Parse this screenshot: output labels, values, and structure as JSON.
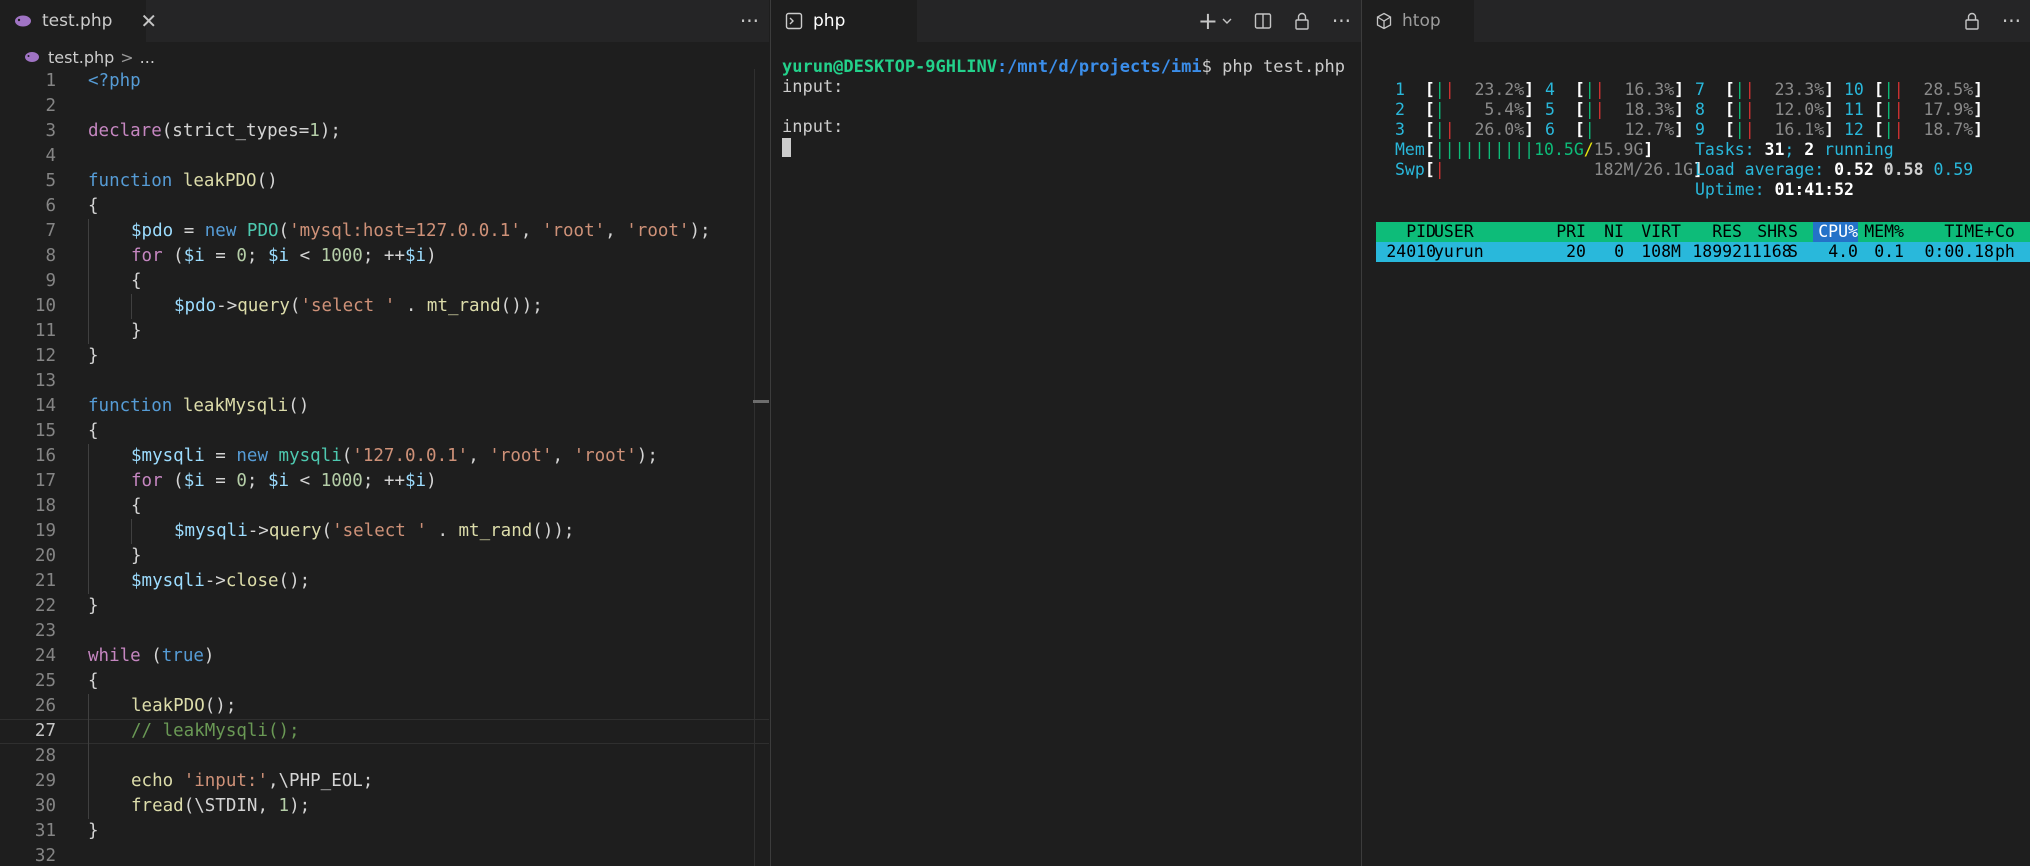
{
  "editor": {
    "tab_label": "test.php",
    "tab_close": "✕",
    "more": "···",
    "breadcrumb_file": "test.php",
    "breadcrumb_sep": ">",
    "breadcrumb_rest": "...",
    "lines": [
      {
        "n": "1",
        "tokens": [
          {
            "t": "<?php",
            "c": "t-kw"
          }
        ]
      },
      {
        "n": "2",
        "tokens": []
      },
      {
        "n": "3",
        "tokens": [
          {
            "t": "declare",
            "c": "t-cf"
          },
          {
            "t": "(strict_types=",
            "c": "t-plain"
          },
          {
            "t": "1",
            "c": "t-num"
          },
          {
            "t": ");",
            "c": "t-plain"
          }
        ]
      },
      {
        "n": "4",
        "tokens": []
      },
      {
        "n": "5",
        "tokens": [
          {
            "t": "function ",
            "c": "t-kw"
          },
          {
            "t": "leakPDO",
            "c": "t-fn"
          },
          {
            "t": "()",
            "c": "t-plain"
          }
        ]
      },
      {
        "n": "6",
        "tokens": [
          {
            "t": "{",
            "c": "t-plain"
          }
        ]
      },
      {
        "n": "7",
        "indent": 1,
        "tokens": [
          {
            "t": "$pdo",
            "c": "t-var"
          },
          {
            "t": " = ",
            "c": "t-plain"
          },
          {
            "t": "new ",
            "c": "t-kw"
          },
          {
            "t": "PDO",
            "c": "t-cls"
          },
          {
            "t": "(",
            "c": "t-plain"
          },
          {
            "t": "'mysql:host=127.0.0.1'",
            "c": "t-str"
          },
          {
            "t": ", ",
            "c": "t-plain"
          },
          {
            "t": "'root'",
            "c": "t-str"
          },
          {
            "t": ", ",
            "c": "t-plain"
          },
          {
            "t": "'root'",
            "c": "t-str"
          },
          {
            "t": ");",
            "c": "t-plain"
          }
        ]
      },
      {
        "n": "8",
        "indent": 1,
        "tokens": [
          {
            "t": "for",
            "c": "t-cf"
          },
          {
            "t": " (",
            "c": "t-plain"
          },
          {
            "t": "$i",
            "c": "t-var"
          },
          {
            "t": " = ",
            "c": "t-plain"
          },
          {
            "t": "0",
            "c": "t-num"
          },
          {
            "t": "; ",
            "c": "t-plain"
          },
          {
            "t": "$i",
            "c": "t-var"
          },
          {
            "t": " < ",
            "c": "t-plain"
          },
          {
            "t": "1000",
            "c": "t-num"
          },
          {
            "t": "; ++",
            "c": "t-plain"
          },
          {
            "t": "$i",
            "c": "t-var"
          },
          {
            "t": ")",
            "c": "t-plain"
          }
        ]
      },
      {
        "n": "9",
        "indent": 1,
        "tokens": [
          {
            "t": "{",
            "c": "t-plain"
          }
        ]
      },
      {
        "n": "10",
        "indent": 2,
        "tokens": [
          {
            "t": "$pdo",
            "c": "t-var"
          },
          {
            "t": "->",
            "c": "t-plain"
          },
          {
            "t": "query",
            "c": "t-fn"
          },
          {
            "t": "(",
            "c": "t-plain"
          },
          {
            "t": "'select '",
            "c": "t-str"
          },
          {
            "t": " . ",
            "c": "t-plain"
          },
          {
            "t": "mt_rand",
            "c": "t-fn"
          },
          {
            "t": "());",
            "c": "t-plain"
          }
        ]
      },
      {
        "n": "11",
        "indent": 1,
        "tokens": [
          {
            "t": "}",
            "c": "t-plain"
          }
        ]
      },
      {
        "n": "12",
        "tokens": [
          {
            "t": "}",
            "c": "t-plain"
          }
        ]
      },
      {
        "n": "13",
        "tokens": []
      },
      {
        "n": "14",
        "tokens": [
          {
            "t": "function ",
            "c": "t-kw"
          },
          {
            "t": "leakMysqli",
            "c": "t-fn"
          },
          {
            "t": "()",
            "c": "t-plain"
          }
        ]
      },
      {
        "n": "15",
        "tokens": [
          {
            "t": "{",
            "c": "t-plain"
          }
        ]
      },
      {
        "n": "16",
        "indent": 1,
        "tokens": [
          {
            "t": "$mysqli",
            "c": "t-var"
          },
          {
            "t": " = ",
            "c": "t-plain"
          },
          {
            "t": "new ",
            "c": "t-kw"
          },
          {
            "t": "mysqli",
            "c": "t-cls"
          },
          {
            "t": "(",
            "c": "t-plain"
          },
          {
            "t": "'127.0.0.1'",
            "c": "t-str"
          },
          {
            "t": ", ",
            "c": "t-plain"
          },
          {
            "t": "'root'",
            "c": "t-str"
          },
          {
            "t": ", ",
            "c": "t-plain"
          },
          {
            "t": "'root'",
            "c": "t-str"
          },
          {
            "t": ");",
            "c": "t-plain"
          }
        ]
      },
      {
        "n": "17",
        "indent": 1,
        "tokens": [
          {
            "t": "for",
            "c": "t-cf"
          },
          {
            "t": " (",
            "c": "t-plain"
          },
          {
            "t": "$i",
            "c": "t-var"
          },
          {
            "t": " = ",
            "c": "t-plain"
          },
          {
            "t": "0",
            "c": "t-num"
          },
          {
            "t": "; ",
            "c": "t-plain"
          },
          {
            "t": "$i",
            "c": "t-var"
          },
          {
            "t": " < ",
            "c": "t-plain"
          },
          {
            "t": "1000",
            "c": "t-num"
          },
          {
            "t": "; ++",
            "c": "t-plain"
          },
          {
            "t": "$i",
            "c": "t-var"
          },
          {
            "t": ")",
            "c": "t-plain"
          }
        ]
      },
      {
        "n": "18",
        "indent": 1,
        "tokens": [
          {
            "t": "{",
            "c": "t-plain"
          }
        ]
      },
      {
        "n": "19",
        "indent": 2,
        "tokens": [
          {
            "t": "$mysqli",
            "c": "t-var"
          },
          {
            "t": "->",
            "c": "t-plain"
          },
          {
            "t": "query",
            "c": "t-fn"
          },
          {
            "t": "(",
            "c": "t-plain"
          },
          {
            "t": "'select '",
            "c": "t-str"
          },
          {
            "t": " . ",
            "c": "t-plain"
          },
          {
            "t": "mt_rand",
            "c": "t-fn"
          },
          {
            "t": "());",
            "c": "t-plain"
          }
        ]
      },
      {
        "n": "20",
        "indent": 1,
        "tokens": [
          {
            "t": "}",
            "c": "t-plain"
          }
        ]
      },
      {
        "n": "21",
        "indent": 1,
        "tokens": [
          {
            "t": "$mysqli",
            "c": "t-var"
          },
          {
            "t": "->",
            "c": "t-plain"
          },
          {
            "t": "close",
            "c": "t-fn"
          },
          {
            "t": "();",
            "c": "t-plain"
          }
        ]
      },
      {
        "n": "22",
        "tokens": [
          {
            "t": "}",
            "c": "t-plain"
          }
        ]
      },
      {
        "n": "23",
        "tokens": []
      },
      {
        "n": "24",
        "tokens": [
          {
            "t": "while",
            "c": "t-cf"
          },
          {
            "t": " (",
            "c": "t-plain"
          },
          {
            "t": "true",
            "c": "t-kw"
          },
          {
            "t": ")",
            "c": "t-plain"
          }
        ]
      },
      {
        "n": "25",
        "tokens": [
          {
            "t": "{",
            "c": "t-plain"
          }
        ]
      },
      {
        "n": "26",
        "indent": 1,
        "tokens": [
          {
            "t": "leakPDO",
            "c": "t-fn"
          },
          {
            "t": "();",
            "c": "t-plain"
          }
        ]
      },
      {
        "n": "27",
        "indent": 1,
        "current": true,
        "tokens": [
          {
            "t": "// leakMysqli();",
            "c": "t-cm"
          }
        ]
      },
      {
        "n": "28",
        "indent": 1,
        "tokens": []
      },
      {
        "n": "29",
        "indent": 1,
        "tokens": [
          {
            "t": "echo ",
            "c": "t-fn"
          },
          {
            "t": "'input:'",
            "c": "t-str"
          },
          {
            "t": ",\\PHP_EOL;",
            "c": "t-plain"
          }
        ]
      },
      {
        "n": "30",
        "indent": 1,
        "tokens": [
          {
            "t": "fread",
            "c": "t-fn"
          },
          {
            "t": "(\\STDIN, ",
            "c": "t-plain"
          },
          {
            "t": "1",
            "c": "t-num"
          },
          {
            "t": ");",
            "c": "t-plain"
          }
        ]
      },
      {
        "n": "31",
        "tokens": [
          {
            "t": "}",
            "c": "t-plain"
          }
        ]
      },
      {
        "n": "32",
        "tokens": []
      }
    ]
  },
  "terminal": {
    "tab_label": "php",
    "add": "+",
    "more": "···",
    "prompt_user": "yurun@DESKTOP-9GHLINV",
    "prompt_path": ":/mnt/d/projects/imi",
    "prompt_cmd": "$ php test.php",
    "output": [
      "input:",
      "",
      "input:"
    ]
  },
  "htop": {
    "tab_label": "htop",
    "more": "···",
    "cpus": [
      {
        "id": "1",
        "pct": "23.2%"
      },
      {
        "id": "2",
        "pct": " 5.4%"
      },
      {
        "id": "3",
        "pct": "26.0%"
      },
      {
        "id": "4",
        "pct": "16.3%"
      },
      {
        "id": "5",
        "pct": "18.3%"
      },
      {
        "id": "6",
        "pct": "12.7%"
      },
      {
        "id": "7",
        "pct": "23.3%"
      },
      {
        "id": "8",
        "pct": "12.0%"
      },
      {
        "id": "9",
        "pct": "16.1%"
      },
      {
        "id": "10",
        "pct": "28.5%"
      },
      {
        "id": "11",
        "pct": "17.9%"
      },
      {
        "id": "12",
        "pct": "18.7%"
      }
    ],
    "mem_label": "Mem",
    "mem_used": "10.5G",
    "mem_total": "15.9G",
    "swp_label": "Swp",
    "swp_value": "182M/26.1G",
    "tasks_label": "Tasks: ",
    "tasks_count": "31",
    "tasks_sep": "; ",
    "running_count": "2",
    "running_label": " running",
    "load_label": "Load average: ",
    "load1": "0.52",
    "load5": "0.58",
    "load15": "0.59",
    "uptime_label": "Uptime: ",
    "uptime": "01:41:52",
    "columns": [
      "PID",
      "USER",
      "PRI",
      "NI",
      "VIRT",
      "RES",
      "SHR",
      "S",
      "CPU%",
      "MEM%",
      "TIME+",
      "Co"
    ],
    "process": [
      "24010",
      "yurun",
      "20",
      "0",
      "108M",
      "18992",
      "11168",
      "S",
      "4.0",
      "0.1",
      "0:00.18",
      "ph"
    ]
  },
  "colors": {
    "accent": "#007acc",
    "htop_header": "#0dbc79",
    "htop_selected": "#29b8db"
  }
}
